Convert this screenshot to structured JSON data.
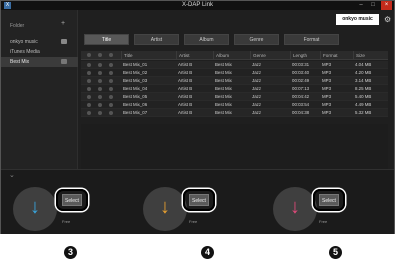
{
  "window": {
    "title": "X-DAP Link",
    "app_icon": "app-icon",
    "controls": {
      "minimize": "–",
      "maximize": "□",
      "close": "×"
    }
  },
  "sidebar": {
    "heading": "Folder",
    "add_label": "+",
    "items": [
      {
        "label": "onkyo music",
        "icon": "folder-icon",
        "selected": false
      },
      {
        "label": "iTunes Media",
        "icon": "",
        "selected": false
      },
      {
        "label": "Best Mix",
        "icon": "playlist-icon",
        "selected": true
      }
    ]
  },
  "header": {
    "brand_logo": "onkyo music",
    "settings_icon": "gear-icon"
  },
  "tabs": [
    {
      "label": "Title",
      "selected": true
    },
    {
      "label": "Artist",
      "selected": false
    },
    {
      "label": "Album",
      "selected": false
    },
    {
      "label": "Genre",
      "selected": false
    },
    {
      "label": "Format",
      "selected": false
    }
  ],
  "table": {
    "columns": [
      "Title",
      "Artist",
      "Album",
      "Genre",
      "Length",
      "Format",
      "Size"
    ],
    "rows": [
      [
        "Best Mix_01",
        "Artist B",
        "Best Mix",
        "Jazz",
        "00:03:31",
        "MP3",
        "4.04 MB"
      ],
      [
        "Best Mix_02",
        "Artist B",
        "Best Mix",
        "Jazz",
        "00:03:40",
        "MP3",
        "4.20 MB"
      ],
      [
        "Best Mix_03",
        "Artist B",
        "Best Mix",
        "Jazz",
        "00:02:49",
        "MP3",
        "3.14 MB"
      ],
      [
        "Best Mix_04",
        "Artist B",
        "Best Mix",
        "Jazz",
        "00:07:13",
        "MP3",
        "8.25 MB"
      ],
      [
        "Best Mix_05",
        "Artist B",
        "Best Mix",
        "Jazz",
        "00:04:42",
        "MP3",
        "5.40 MB"
      ],
      [
        "Best Mix_06",
        "Artist B",
        "Best Mix",
        "Jazz",
        "00:03:54",
        "MP3",
        "4.49 MB"
      ],
      [
        "Best Mix_07",
        "Artist B",
        "Best Mix",
        "Jazz",
        "00:04:38",
        "MP3",
        "5.32 MB"
      ]
    ]
  },
  "devices": [
    {
      "arrow": "↓",
      "arrow_color": "#39a6de",
      "select_label": "Select",
      "free_label": "Free",
      "callout": "3"
    },
    {
      "arrow": "↓",
      "arrow_color": "#e8a030",
      "select_label": "Select",
      "free_label": "Free",
      "callout": "4"
    },
    {
      "arrow": "↓",
      "arrow_color": "#e04a7a",
      "select_label": "Select",
      "free_label": "Free",
      "callout": "5"
    }
  ],
  "bottom": {
    "collapse_icon": "⌄"
  }
}
